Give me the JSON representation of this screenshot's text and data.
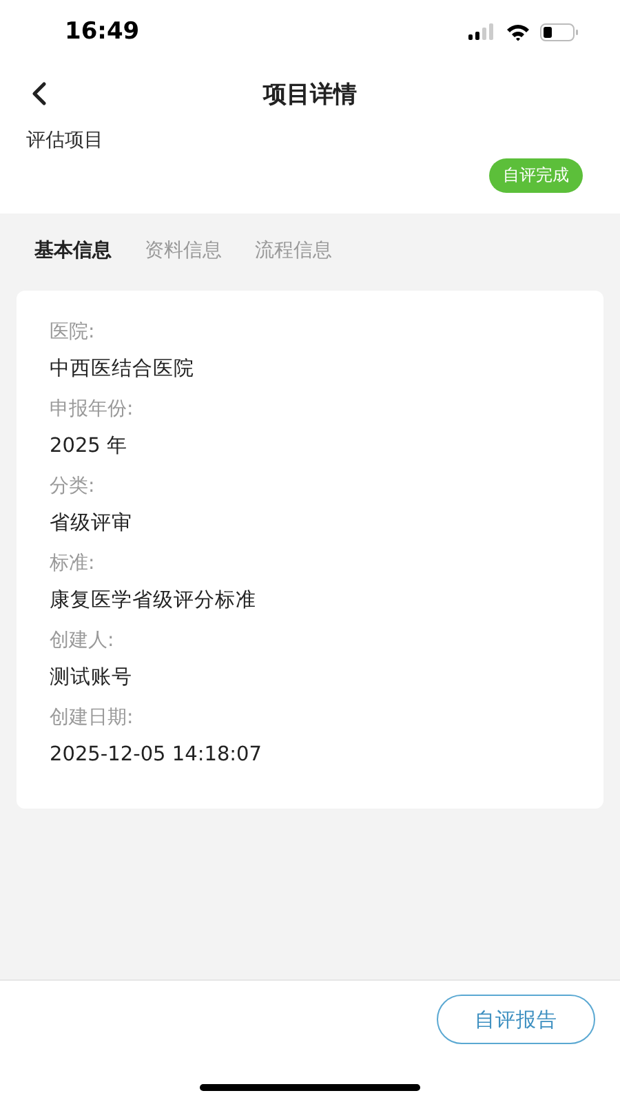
{
  "status_bar": {
    "time": "16:49"
  },
  "header": {
    "title": "项目详情"
  },
  "project": {
    "type": "评估项目",
    "status": "自评完成"
  },
  "tabs": [
    {
      "label": "基本信息",
      "selected": true
    },
    {
      "label": "资料信息",
      "selected": false
    },
    {
      "label": "流程信息",
      "selected": false
    }
  ],
  "fields": [
    {
      "label": "医院:",
      "value": "中西医结合医院"
    },
    {
      "label": "申报年份:",
      "value": "2025 年"
    },
    {
      "label": "分类:",
      "value": "省级评审"
    },
    {
      "label": "标准:",
      "value": "康复医学省级评分标准"
    },
    {
      "label": "创建人:",
      "value": "测试账号"
    },
    {
      "label": "创建日期:",
      "value": "2025-12-05 14:18:07"
    }
  ],
  "footer": {
    "button": "自评报告"
  }
}
